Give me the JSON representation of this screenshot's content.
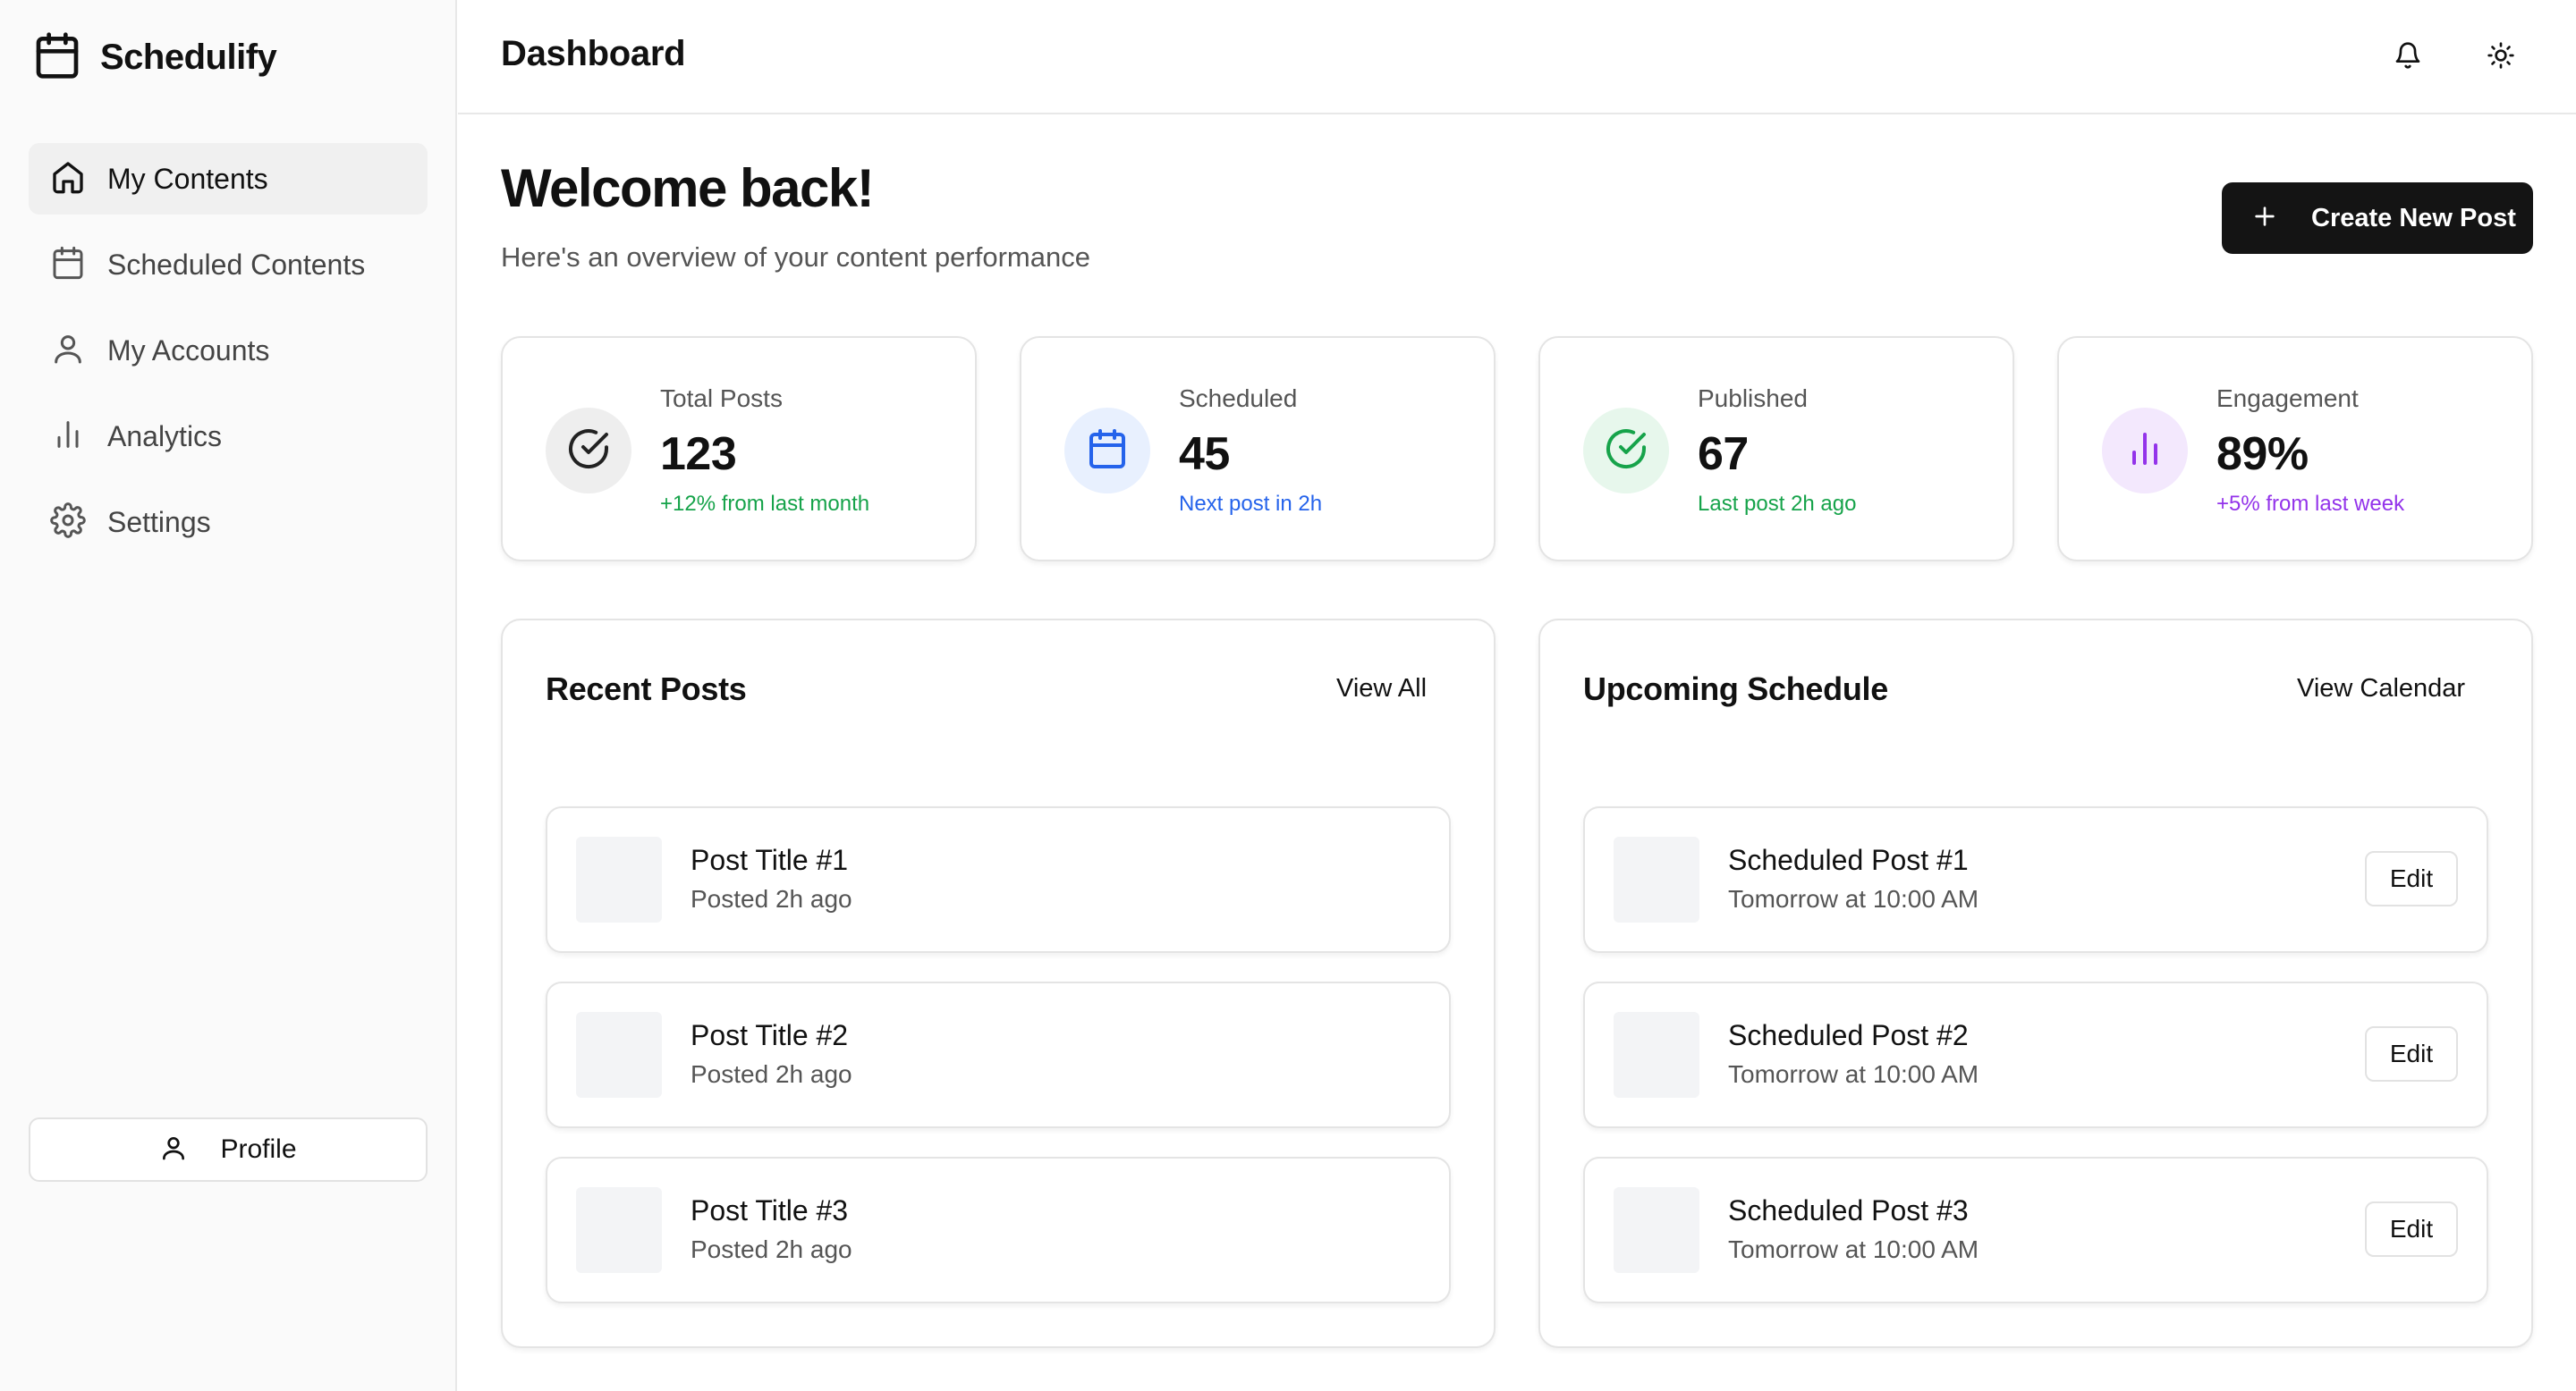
{
  "app": {
    "name": "Schedulify"
  },
  "sidebar": {
    "items": [
      {
        "label": "My Contents",
        "icon": "home-icon",
        "active": true
      },
      {
        "label": "Scheduled Contents",
        "icon": "calendar-icon"
      },
      {
        "label": "My Accounts",
        "icon": "user-icon"
      },
      {
        "label": "Analytics",
        "icon": "bar-chart-icon"
      },
      {
        "label": "Settings",
        "icon": "gear-icon"
      }
    ],
    "profile_label": "Profile"
  },
  "header": {
    "title": "Dashboard",
    "icons": [
      "bell-icon",
      "sun-icon"
    ]
  },
  "welcome": {
    "title": "Welcome back!",
    "subtitle": "Here's an overview of your content performance",
    "create_button": "Create New Post"
  },
  "stats": [
    {
      "label": "Total Posts",
      "value": "123",
      "note": "+12% from last month",
      "note_color": "#16a34a",
      "icon": "check-circle-icon",
      "icon_bg": "#eeeeee",
      "icon_color": "#222222"
    },
    {
      "label": "Scheduled",
      "value": "45",
      "note": "Next post in 2h",
      "note_color": "#2563eb",
      "icon": "calendar-icon",
      "icon_bg": "#e8f0fe",
      "icon_color": "#2563eb"
    },
    {
      "label": "Published",
      "value": "67",
      "note": "Last post 2h ago",
      "note_color": "#16a34a",
      "icon": "check-circle-icon",
      "icon_bg": "#e7f7ec",
      "icon_color": "#16a34a"
    },
    {
      "label": "Engagement",
      "value": "89%",
      "note": "+5% from last week",
      "note_color": "#9333ea",
      "icon": "bar-chart-icon",
      "icon_bg": "#f3e8fd",
      "icon_color": "#9333ea"
    }
  ],
  "recent_posts": {
    "title": "Recent Posts",
    "link": "View All",
    "items": [
      {
        "title": "Post Title #1",
        "subtitle": "Posted 2h ago"
      },
      {
        "title": "Post Title #2",
        "subtitle": "Posted 2h ago"
      },
      {
        "title": "Post Title #3",
        "subtitle": "Posted 2h ago"
      }
    ]
  },
  "upcoming": {
    "title": "Upcoming Schedule",
    "link": "View Calendar",
    "edit_label": "Edit",
    "items": [
      {
        "title": "Scheduled Post #1",
        "subtitle": "Tomorrow at 10:00 AM"
      },
      {
        "title": "Scheduled Post #2",
        "subtitle": "Tomorrow at 10:00 AM"
      },
      {
        "title": "Scheduled Post #3",
        "subtitle": "Tomorrow at 10:00 AM"
      }
    ]
  }
}
